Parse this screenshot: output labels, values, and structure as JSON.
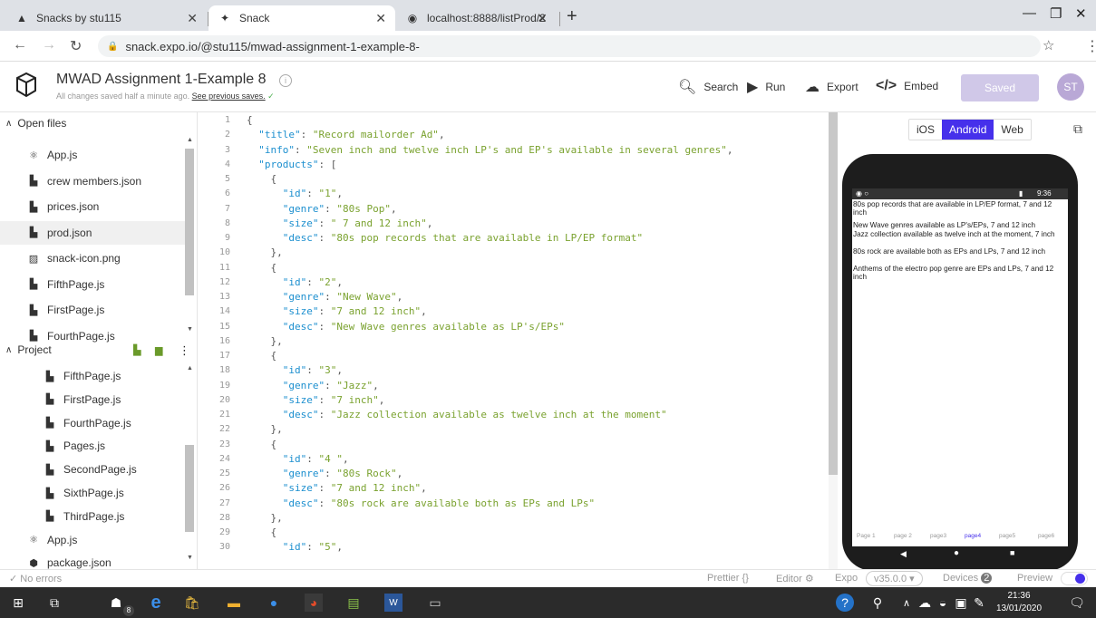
{
  "browser": {
    "tabs": [
      {
        "title": "Snacks by stu115",
        "icon": "expo-icon"
      },
      {
        "title": "Snack",
        "icon": "snack-icon"
      },
      {
        "title": "localhost:8888/listProd/2",
        "icon": "globe-icon"
      }
    ],
    "url": "snack.expo.io/@stu115/mwad-assignment-1-example-8-"
  },
  "header": {
    "title": "MWAD Assignment 1-Example 8",
    "subtitle": "All changes saved half a minute ago.",
    "subtitle_link": "See previous saves.",
    "search_label": "Search",
    "run_label": "Run",
    "export_label": "Export",
    "embed_label": "Embed",
    "saved_label": "Saved",
    "avatar_initials": "ST"
  },
  "sidebar": {
    "open_files_label": "Open files",
    "open_files": [
      "App.js",
      "crew members.json",
      "prices.json",
      "prod.json",
      "snack-icon.png",
      "FifthPage.js",
      "FirstPage.js",
      "FourthPage.js"
    ],
    "project_label": "Project",
    "project_files": [
      "FifthPage.js",
      "FirstPage.js",
      "FourthPage.js",
      "Pages.js",
      "SecondPage.js",
      "SixthPage.js",
      "ThirdPage.js",
      "App.js",
      "package.json"
    ]
  },
  "editor": {
    "lines": [
      "{",
      "  \"title\": \"Record mailorder Ad\",",
      "  \"info\": \"Seven inch and twelve inch LP's and EP's available in several genres\",",
      "  \"products\": [",
      "    {",
      "      \"id\": \"1\",",
      "      \"genre\": \"80s Pop\",",
      "      \"size\": \" 7 and 12 inch\",",
      "      \"desc\": \"80s pop records that are available in LP/EP format\"",
      "    },",
      "    {",
      "      \"id\": \"2\",",
      "      \"genre\": \"New Wave\",",
      "      \"size\": \"7 and 12 inch\",",
      "      \"desc\": \"New Wave genres available as LP's/EPs\"",
      "    },",
      "    {",
      "      \"id\": \"3\",",
      "      \"genre\": \"Jazz\",",
      "      \"size\": \"7 inch\",",
      "      \"desc\": \"Jazz collection available as twelve inch at the moment\"",
      "    },",
      "    {",
      "      \"id\": \"4 \",",
      "      \"genre\": \"80s Rock\",",
      "      \"size\": \"7 and 12 inch\",",
      "      \"desc\": \"80s rock are available both as EPs and LPs\"",
      "    },",
      "    {",
      "      \"id\": \"5\","
    ]
  },
  "preview": {
    "tabs": [
      "iOS",
      "Android",
      "Web"
    ],
    "active_tab": "Android",
    "status_time": "9:36",
    "lines": [
      "80s pop records that are available in LP/EP format,  7 and 12 inch",
      "New Wave genres available as LP's/EPs, 7 and 12 inch",
      "Jazz collection available as twelve inch at the moment, 7 inch",
      "80s rock are available both as EPs and LPs, 7 and 12 inch",
      "Anthems of the electro pop genre are EPs and LPs, 7 and 12 inch"
    ],
    "nav": [
      "Page 1",
      "page 2",
      "page3",
      "page4",
      "page5",
      "page6"
    ],
    "active_nav": "page4"
  },
  "footer": {
    "errors": "No errors",
    "prettier": "Prettier",
    "prettier_glyph": "{}",
    "editor": "Editor",
    "expo": "Expo",
    "version": "v35.0.0",
    "devices": "Devices",
    "devices_count": "2",
    "preview": "Preview"
  },
  "taskbar": {
    "time": "21:36",
    "date": "13/01/2020",
    "badge": "8"
  },
  "colors": {
    "accent": "#4630eb",
    "json_key": "#1c8fcf",
    "json_string": "#7aa22f"
  }
}
